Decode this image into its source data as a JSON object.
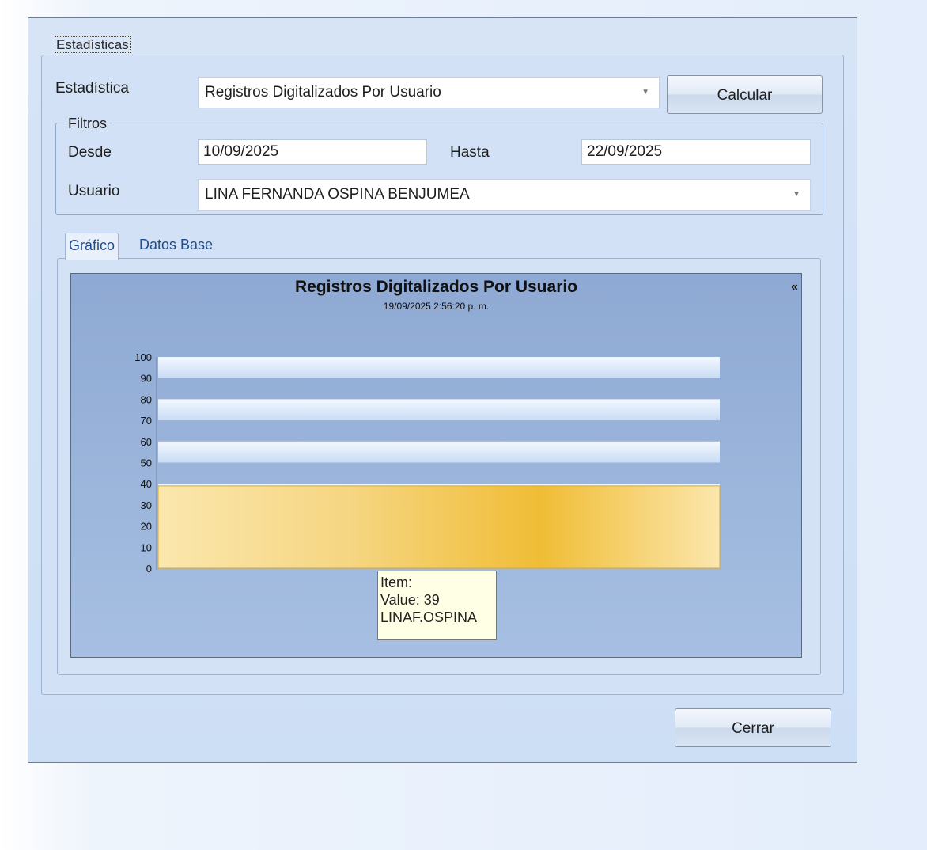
{
  "group": {
    "title": "Estadísticas"
  },
  "form": {
    "estadistica_label": "Estadística",
    "estadistica_value": "Registros Digitalizados Por Usuario",
    "calcular_label": "Calcular",
    "filtros_label": "Filtros",
    "desde_label": "Desde",
    "desde_value": "10/09/2025",
    "hasta_label": "Hasta",
    "hasta_value": "22/09/2025",
    "usuario_label": "Usuario",
    "usuario_value": "LINA FERNANDA OSPINA BENJUMEA"
  },
  "tabs": [
    {
      "label": "Gráfico",
      "active": true
    },
    {
      "label": "Datos Base",
      "active": false
    }
  ],
  "chart": {
    "title": "Registros Digitalizados Por Usuario",
    "subtitle": "19/09/2025 2:56:20 p. m.",
    "collapse_icon": "«",
    "y_ticks": [
      "100",
      "90",
      "80",
      "70",
      "60",
      "50",
      "40",
      "30",
      "20",
      "10",
      "0"
    ]
  },
  "chart_data": {
    "type": "bar",
    "categories": [
      "LINAF.OSPINA"
    ],
    "values": [
      39
    ],
    "title": "Registros Digitalizados Por Usuario",
    "subtitle": "19/09/2025 2:56:20 p. m.",
    "ylim": [
      0,
      100
    ],
    "bar_color": "#f0be3a",
    "grid": true
  },
  "tooltip": {
    "line1": "Item:",
    "line2": "Value: 39",
    "line3": "LINAF.OSPINA"
  },
  "footer": {
    "cerrar_label": "Cerrar"
  }
}
